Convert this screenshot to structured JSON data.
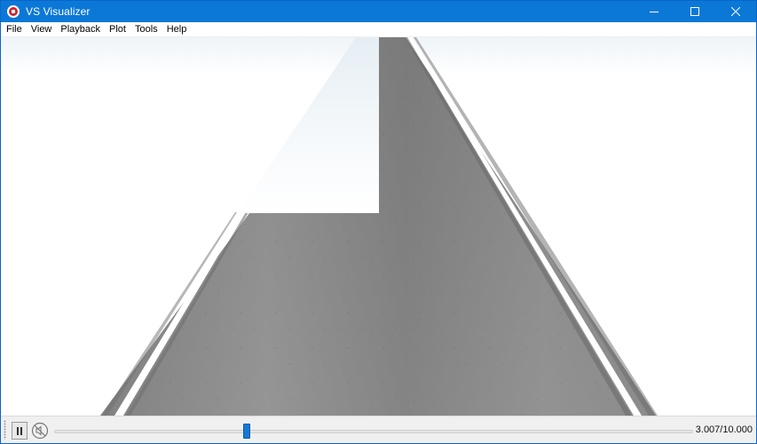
{
  "window": {
    "title": "VS Visualizer",
    "accent_color": "#0b78d7",
    "controls": [
      "minimize-icon",
      "maximize-icon",
      "close-icon"
    ]
  },
  "menu": {
    "items": [
      "File",
      "View",
      "Playback",
      "Plot",
      "Tools",
      "Help"
    ]
  },
  "scene": {
    "description_icon": "road-3d-view",
    "road_color": "#8c8c8c",
    "line_color": "#ffffff",
    "sky_color": "#ffffff"
  },
  "playback": {
    "state": "playing",
    "pause_icon": "pause-icon",
    "mute_icon": "muted-speaker-icon",
    "current_time": 3.007,
    "total_time": 10.0,
    "progress_fraction": 0.3007,
    "time_text": "3.007/10.000"
  }
}
